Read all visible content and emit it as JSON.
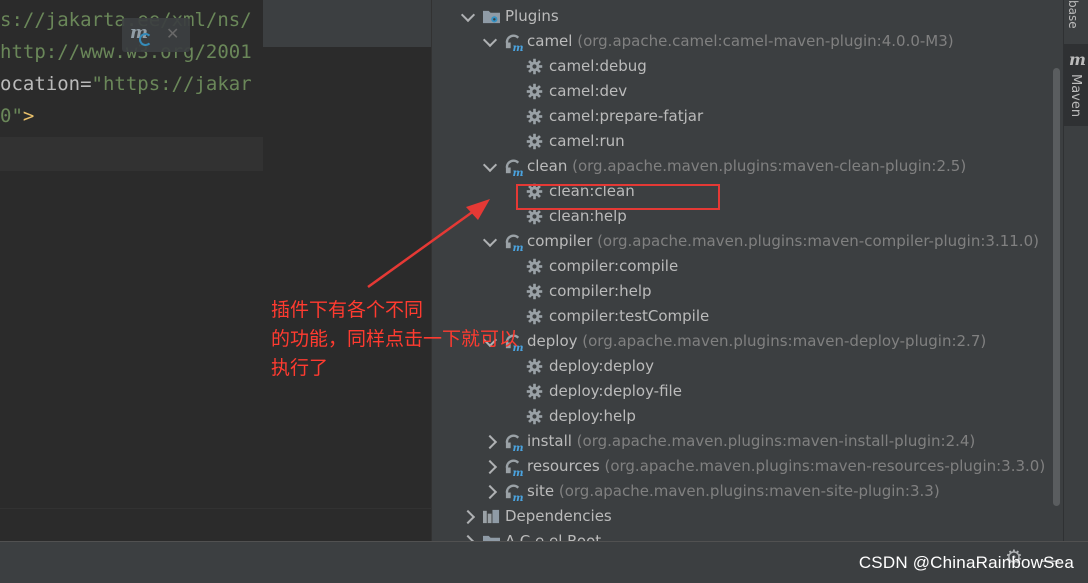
{
  "editor": {
    "lines": [
      [
        {
          "t": "s://jakarta.ee/xml/ns/",
          "c": "str"
        }
      ],
      [
        {
          "t": "http://www.w3.org/2001",
          "c": "str"
        }
      ],
      [
        {
          "t": "ocation",
          "c": "attr"
        },
        {
          "t": "=",
          "c": "eq"
        },
        {
          "t": "\"https://jakar",
          "c": "str"
        }
      ],
      [
        {
          "t": "0\"",
          "c": "str"
        },
        {
          "t": ">",
          "c": "tag"
        }
      ]
    ]
  },
  "maven": {
    "tab_label": "Maven",
    "db_tab_label": "base",
    "tree": [
      {
        "indent": 0,
        "exp": "down",
        "icon": "folder",
        "label": "Plugins",
        "coord": ""
      },
      {
        "indent": 1,
        "exp": "down",
        "icon": "plugin",
        "label": "camel",
        "coord": "(org.apache.camel:camel-maven-plugin:4.0.0-M3)"
      },
      {
        "indent": 2,
        "exp": "",
        "icon": "gear",
        "label": "camel:debug",
        "coord": ""
      },
      {
        "indent": 2,
        "exp": "",
        "icon": "gear",
        "label": "camel:dev",
        "coord": ""
      },
      {
        "indent": 2,
        "exp": "",
        "icon": "gear",
        "label": "camel:prepare-fatjar",
        "coord": ""
      },
      {
        "indent": 2,
        "exp": "",
        "icon": "gear",
        "label": "camel:run",
        "coord": ""
      },
      {
        "indent": 1,
        "exp": "down",
        "icon": "plugin",
        "label": "clean",
        "coord": "(org.apache.maven.plugins:maven-clean-plugin:2.5)"
      },
      {
        "indent": 2,
        "exp": "",
        "icon": "gear",
        "label": "clean:clean",
        "coord": ""
      },
      {
        "indent": 2,
        "exp": "",
        "icon": "gear",
        "label": "clean:help",
        "coord": ""
      },
      {
        "indent": 1,
        "exp": "down",
        "icon": "plugin",
        "label": "compiler",
        "coord": "(org.apache.maven.plugins:maven-compiler-plugin:3.11.0)"
      },
      {
        "indent": 2,
        "exp": "",
        "icon": "gear",
        "label": "compiler:compile",
        "coord": ""
      },
      {
        "indent": 2,
        "exp": "",
        "icon": "gear",
        "label": "compiler:help",
        "coord": ""
      },
      {
        "indent": 2,
        "exp": "",
        "icon": "gear",
        "label": "compiler:testCompile",
        "coord": ""
      },
      {
        "indent": 1,
        "exp": "down",
        "icon": "plugin",
        "label": "deploy",
        "coord": "(org.apache.maven.plugins:maven-deploy-plugin:2.7)"
      },
      {
        "indent": 2,
        "exp": "",
        "icon": "gear",
        "label": "deploy:deploy",
        "coord": ""
      },
      {
        "indent": 2,
        "exp": "",
        "icon": "gear",
        "label": "deploy:deploy-file",
        "coord": ""
      },
      {
        "indent": 2,
        "exp": "",
        "icon": "gear",
        "label": "deploy:help",
        "coord": ""
      },
      {
        "indent": 1,
        "exp": "right",
        "icon": "plugin",
        "label": "install",
        "coord": "(org.apache.maven.plugins:maven-install-plugin:2.4)"
      },
      {
        "indent": 1,
        "exp": "right",
        "icon": "plugin",
        "label": "resources",
        "coord": "(org.apache.maven.plugins:maven-resources-plugin:3.3.0)"
      },
      {
        "indent": 1,
        "exp": "right",
        "icon": "plugin",
        "label": "site",
        "coord": "(org.apache.maven.plugins:maven-site-plugin:3.3)"
      },
      {
        "indent": 0,
        "exp": "right",
        "icon": "deps",
        "label": "Dependencies",
        "coord": ""
      },
      {
        "indent": 0,
        "exp": "right",
        "icon": "folder",
        "label": "A.C.e.el.Root",
        "coord": ""
      }
    ]
  },
  "annotation": {
    "lines": [
      "插件下有各个不同",
      "的功能，同样点击一下就可以",
      "执行了"
    ]
  },
  "watermark": "CSDN @ChinaRainbowSea",
  "colors": {
    "annotation": "#e53935",
    "panel_bg": "#3c3f41",
    "editor_bg": "#2b2b2b"
  }
}
